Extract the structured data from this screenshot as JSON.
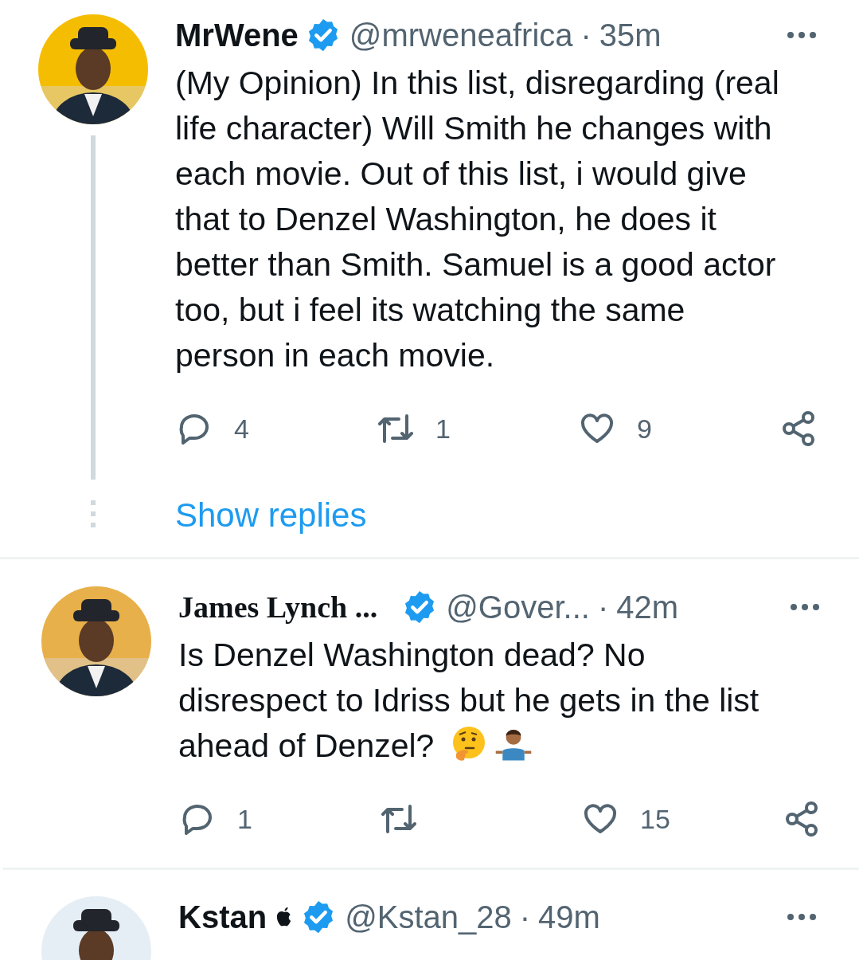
{
  "tweets": [
    {
      "name": "MrWene",
      "verified": true,
      "apple_badge": false,
      "handle": "@mrweneafrica",
      "separator": "·",
      "time": "35m",
      "thread_line": true,
      "text_lines": [
        "(My Opinion) In this list, disregarding (real",
        "life character) Will Smith he changes with",
        "each movie. Out of this list, i would give",
        "that to Denzel Washington, he does it",
        "better than Smith. Samuel is a good actor",
        "too, but i feel its watching the same",
        "person in each movie."
      ],
      "actions": {
        "replies": "4",
        "reposts": "1",
        "likes": "9"
      },
      "show_replies": "Show replies"
    },
    {
      "name": "James Lynch ...",
      "verified": true,
      "apple_badge": false,
      "handle": "@Gover...",
      "separator": "·",
      "time": "42m",
      "thread_line": false,
      "text_lines": [
        "Is Denzel Washington dead? No",
        "disrespect to Idriss but he gets in the list",
        "ahead of Denzel?"
      ],
      "emojis": [
        {
          "kind": "thinking"
        },
        {
          "kind": "shrug"
        }
      ],
      "actions": {
        "replies": "1",
        "likes": "15"
      }
    },
    {
      "name": "Kstan",
      "verified": true,
      "apple_badge": true,
      "handle": "@Kstan_28",
      "separator": "·",
      "time": "49m",
      "thread_line": false
    }
  ]
}
